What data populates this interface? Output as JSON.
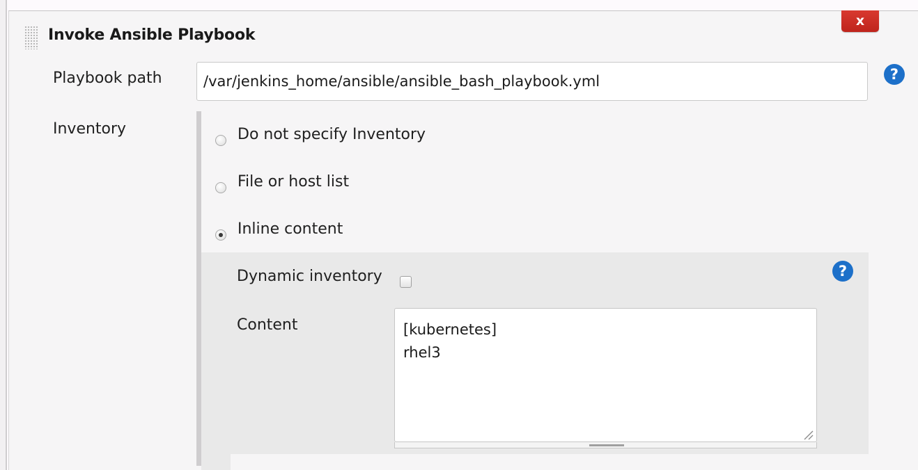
{
  "step": {
    "title": "Invoke Ansible Playbook",
    "delete_label": "x"
  },
  "playbook": {
    "label": "Playbook path",
    "value": "/var/jenkins_home/ansible/ansible_bash_playbook.yml"
  },
  "inventory": {
    "label": "Inventory",
    "options": [
      {
        "label": "Do not specify Inventory",
        "selected": false
      },
      {
        "label": "File or host list",
        "selected": false
      },
      {
        "label": "Inline content",
        "selected": true
      }
    ],
    "dynamic_inventory_label": "Dynamic inventory",
    "dynamic_inventory_checked": false,
    "content_label": "Content",
    "content_value": "[kubernetes]\nrhel3"
  },
  "help_glyph": "?",
  "colors": {
    "delete_button": "#cf3128",
    "help_icon": "#1d70c9",
    "nested_panel": "#e9e9e9"
  },
  "icons": [
    "drag-handle-icon",
    "help-icon",
    "resize-grip-icon"
  ]
}
